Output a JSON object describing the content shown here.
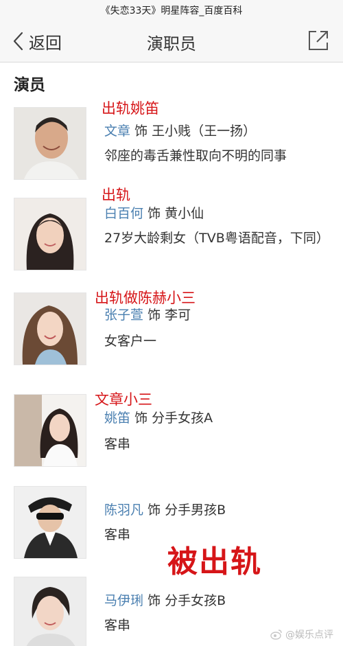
{
  "page": {
    "status_title": "《失恋33天》明星阵容_百度百科"
  },
  "nav": {
    "back_label": "返回",
    "title": "演职员",
    "share_icon": "share-icon"
  },
  "section": {
    "heading": "演员"
  },
  "cast": [
    {
      "annotation": "出轨姚笛",
      "actor": "文章",
      "connector": "饰",
      "role": "王小贱（王一扬）",
      "description": "邻座的毒舌兼性取向不明的同事"
    },
    {
      "annotation": "出轨",
      "actor": "白百何",
      "connector": "饰",
      "role": "黄小仙",
      "description": "27岁大龄剩女（TVB粤语配音，下同）"
    },
    {
      "annotation": "出轨做陈赫小三",
      "actor": "张子萱",
      "connector": "饰",
      "role": "李可",
      "description": "女客户一"
    },
    {
      "annotation": "文章小三",
      "actor": "姚笛",
      "connector": "饰",
      "role": "分手女孩A",
      "description": "客串"
    },
    {
      "annotation": "",
      "actor": "陈羽凡",
      "connector": "饰",
      "role": "分手男孩B",
      "description": "客串"
    },
    {
      "annotation": "",
      "actor": "马伊琍",
      "connector": "饰",
      "role": "分手女孩B",
      "description": "客串"
    }
  ],
  "overlay": {
    "big_annotation": "被出轨",
    "watermark": "@娱乐点评"
  },
  "colors": {
    "annotation_red": "#d61518",
    "actor_link": "#4a7fb0",
    "nav_bg": "#f7f7f7"
  }
}
